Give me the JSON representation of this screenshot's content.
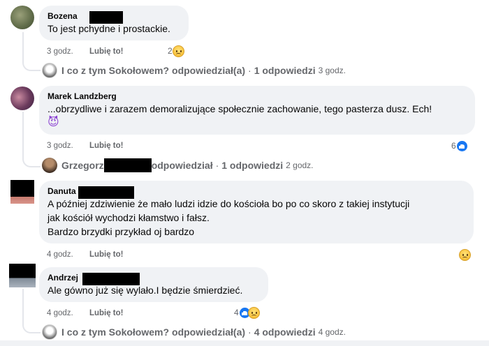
{
  "comments": [
    {
      "author": "Bozena",
      "lines": [
        "To jest pchydne i prostackie."
      ],
      "time": "3 godz.",
      "like": "Lubię to!",
      "reaction_count": "2",
      "replies": {
        "author": "I co z tym Sokołowem?",
        "action": "odpowiedział(a)",
        "sep": "·",
        "count": "1 odpowiedzi",
        "time": "3 godz."
      }
    },
    {
      "author": "Marek Landzberg",
      "lines": [
        "...obrzydliwe i zarazem demoralizujące społecznie zachowanie, tego pasterza dusz. Ech!"
      ],
      "emoji": "😈",
      "time": "3 godz.",
      "like": "Lubię to!",
      "reaction_count": "6",
      "replies": {
        "author": "Grzegorz",
        "action": "odpowiedział",
        "sep": "·",
        "count": "1 odpowiedzi",
        "time": "2 godz."
      }
    },
    {
      "author": "Danuta",
      "lines": [
        "A później zdziwienie że mało ludzi idzie do kościoła bo po co skoro z takiej instytucji",
        "jak kościół wychodzi kłamstwo i fałsz.",
        "Bardzo brzydki przykład oj bardzo"
      ],
      "time": "4 godz.",
      "like": "Lubię to!"
    },
    {
      "author": "Andrzej",
      "lines": [
        "Ale gówno już się wylało.I będzie śmierdzieć."
      ],
      "time": "4 godz.",
      "like": "Lubię to!",
      "reaction_count": "4",
      "replies": {
        "author": "I co z tym Sokołowem?",
        "action": "odpowiedział(a)",
        "sep": "·",
        "count": "4 odpowiedzi",
        "time": "4 godz."
      }
    }
  ],
  "icons": {
    "sad_reaction": "sad-reaction-icon",
    "like_reaction": "like-reaction-icon"
  },
  "colors": {
    "bubble": "#f0f2f5",
    "meta_text": "#65676b",
    "like_blue": "#1877f2"
  }
}
